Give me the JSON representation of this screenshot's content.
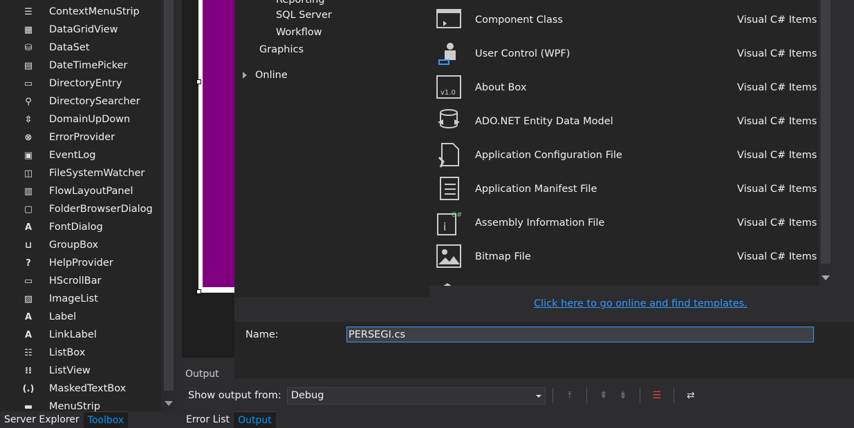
{
  "toolbox": {
    "items": [
      {
        "label": "ContextMenuStrip",
        "icon": "context-menu-strip-icon",
        "glyph": "☰"
      },
      {
        "label": "DataGridView",
        "icon": "data-grid-view-icon",
        "glyph": "▦"
      },
      {
        "label": "DataSet",
        "icon": "dataset-icon",
        "glyph": "⛁"
      },
      {
        "label": "DateTimePicker",
        "icon": "date-time-picker-icon",
        "glyph": "▤"
      },
      {
        "label": "DirectoryEntry",
        "icon": "directory-entry-icon",
        "glyph": "▭"
      },
      {
        "label": "DirectorySearcher",
        "icon": "directory-searcher-icon",
        "glyph": "⚲"
      },
      {
        "label": "DomainUpDown",
        "icon": "domain-up-down-icon",
        "glyph": "⇳"
      },
      {
        "label": "ErrorProvider",
        "icon": "error-provider-icon",
        "glyph": "⊗"
      },
      {
        "label": "EventLog",
        "icon": "event-log-icon",
        "glyph": "▣"
      },
      {
        "label": "FileSystemWatcher",
        "icon": "file-system-watcher-icon",
        "glyph": "◫"
      },
      {
        "label": "FlowLayoutPanel",
        "icon": "flow-layout-panel-icon",
        "glyph": "▥"
      },
      {
        "label": "FolderBrowserDialog",
        "icon": "folder-browser-dialog-icon",
        "glyph": "▢"
      },
      {
        "label": "FontDialog",
        "icon": "font-dialog-icon",
        "glyph": "A"
      },
      {
        "label": "GroupBox",
        "icon": "group-box-icon",
        "glyph": "⊔"
      },
      {
        "label": "HelpProvider",
        "icon": "help-provider-icon",
        "glyph": "?"
      },
      {
        "label": "HScrollBar",
        "icon": "hscrollbar-icon",
        "glyph": "▭"
      },
      {
        "label": "ImageList",
        "icon": "image-list-icon",
        "glyph": "▨"
      },
      {
        "label": "Label",
        "icon": "label-icon",
        "glyph": "A"
      },
      {
        "label": "LinkLabel",
        "icon": "link-label-icon",
        "glyph": "A"
      },
      {
        "label": "ListBox",
        "icon": "list-box-icon",
        "glyph": "☷"
      },
      {
        "label": "ListView",
        "icon": "list-view-icon",
        "glyph": "⁝⁝"
      },
      {
        "label": "MaskedTextBox",
        "icon": "masked-text-box-icon",
        "glyph": "(.)"
      },
      {
        "label": "MenuStrip",
        "icon": "menu-strip-icon",
        "glyph": "▬"
      }
    ]
  },
  "bottom_tabs_left": [
    "Server Explorer",
    "Toolbox"
  ],
  "bottom_tabs_right": [
    "Error List",
    "Output"
  ],
  "dialog": {
    "tree": {
      "reporting": "Reporting",
      "sql_server": "SQL Server",
      "workflow": "Workflow",
      "graphics": "Graphics",
      "online": "Online"
    },
    "templates": [
      {
        "name": "Component Class",
        "type": "Visual C# Items",
        "icon": "component-class-icon"
      },
      {
        "name": "User Control (WPF)",
        "type": "Visual C# Items",
        "icon": "user-control-wpf-icon"
      },
      {
        "name": "About Box",
        "type": "Visual C# Items",
        "icon": "about-box-icon"
      },
      {
        "name": "ADO.NET Entity Data Model",
        "type": "Visual C# Items",
        "icon": "entity-data-model-icon"
      },
      {
        "name": "Application Configuration File",
        "type": "Visual C# Items",
        "icon": "config-file-icon"
      },
      {
        "name": "Application Manifest File",
        "type": "Visual C# Items",
        "icon": "manifest-file-icon"
      },
      {
        "name": "Assembly Information File",
        "type": "Visual C# Items",
        "icon": "assembly-info-icon"
      },
      {
        "name": "Bitmap File",
        "type": "Visual C# Items",
        "icon": "bitmap-file-icon"
      }
    ],
    "online_link": "Click here to go online and find templates.",
    "name_label": "Name:",
    "name_value": "PERSEGI.cs"
  },
  "output": {
    "title": "Output",
    "show_from_label": "Show output from:",
    "source": "Debug"
  },
  "colors": {
    "form_background": "#800080",
    "accent": "#0097fb",
    "link": "#3399ff"
  }
}
